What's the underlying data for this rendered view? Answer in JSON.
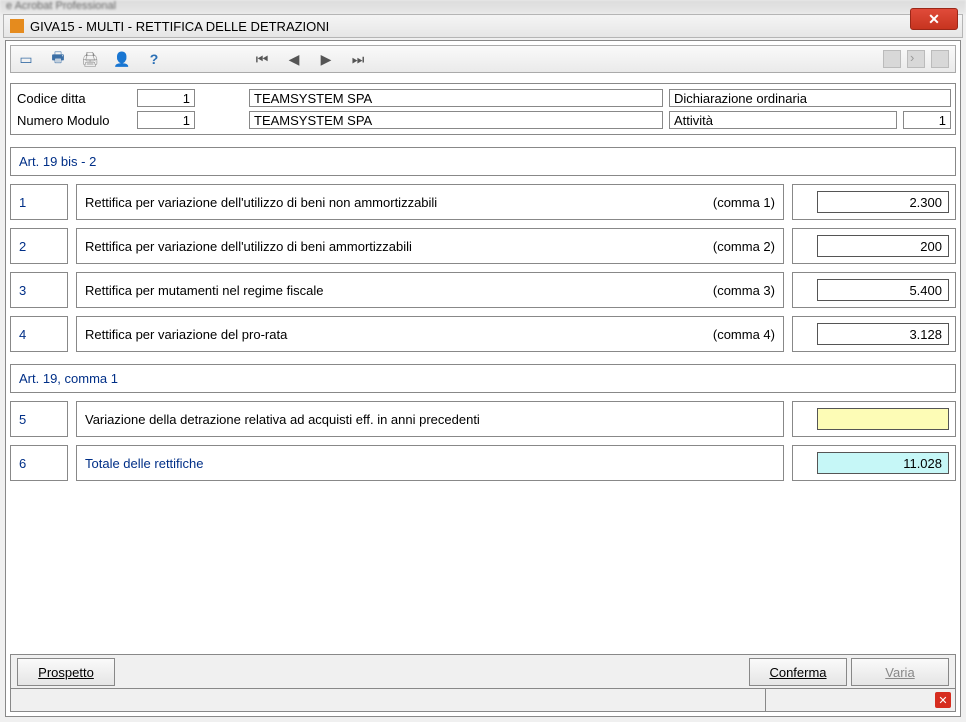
{
  "background_app": "e Acrobat Professional",
  "window": {
    "title": "GIVA15  - MULTI -  RETTIFICA DELLE DETRAZIONI"
  },
  "header": {
    "codice_ditta_label": "Codice ditta",
    "codice_ditta_value": "1",
    "ditta_name": "TEAMSYSTEM SPA",
    "dichiarazione": "Dichiarazione ordinaria",
    "numero_modulo_label": "Numero Modulo",
    "numero_modulo_value": "1",
    "ditta_name2": "TEAMSYSTEM SPA",
    "attivita_label": "Attività",
    "attivita_value": "1"
  },
  "section1_title": "Art. 19 bis - 2",
  "section2_title": "Art. 19, comma 1",
  "rows": [
    {
      "num": "1",
      "desc": "Rettifica per variazione dell'utilizzo di beni non ammortizzabili",
      "comma": "(comma 1)",
      "value": "2.300",
      "style": ""
    },
    {
      "num": "2",
      "desc": "Rettifica per variazione dell'utilizzo di beni ammortizzabili",
      "comma": "(comma 2)",
      "value": "200",
      "style": ""
    },
    {
      "num": "3",
      "desc": "Rettifica per mutamenti nel regime fiscale",
      "comma": "(comma 3)",
      "value": "5.400",
      "style": ""
    },
    {
      "num": "4",
      "desc": "Rettifica per variazione del pro-rata",
      "comma": "(comma 4)",
      "value": "3.128",
      "style": ""
    },
    {
      "num": "5",
      "desc": "Variazione della detrazione relativa ad acquisti eff. in anni precedenti",
      "comma": "",
      "value": "",
      "style": "yellow"
    },
    {
      "num": "6",
      "desc": "Totale delle rettifiche",
      "comma": "",
      "value": "11.028",
      "style": "cyan",
      "blue": true
    }
  ],
  "buttons": {
    "prospetto": "Prospetto",
    "conferma": "Conferma",
    "varia": "Varia"
  }
}
